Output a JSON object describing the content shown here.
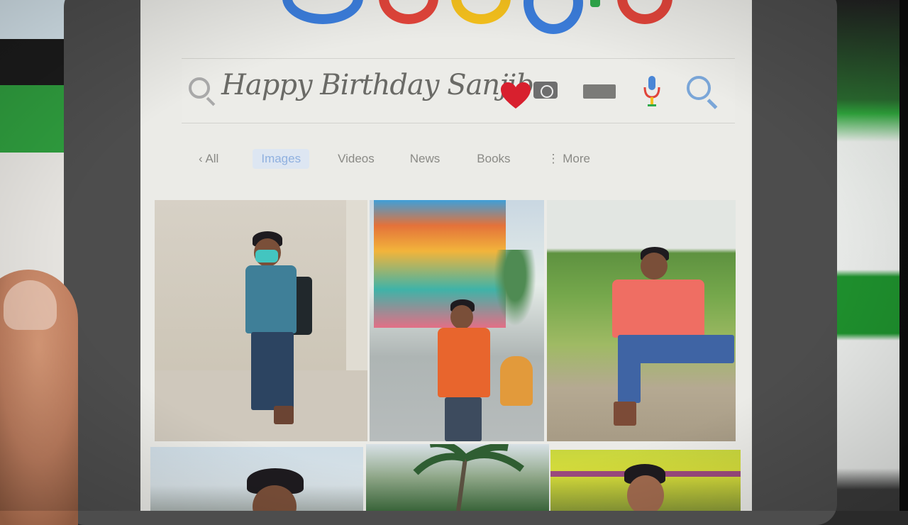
{
  "search": {
    "query": "Happy Birthday Sanjib"
  },
  "tabs": [
    {
      "label": "‹ All"
    },
    {
      "label": "Images",
      "active": true
    },
    {
      "label": "Videos"
    },
    {
      "label": "News"
    },
    {
      "label": "Books"
    },
    {
      "label": "⋮ More"
    }
  ],
  "icons": [
    "search-icon",
    "heart-icon",
    "camera-icon",
    "keyboard-icon",
    "microphone-icon",
    "search-submit-icon",
    "google-logo"
  ],
  "colors": {
    "google_blue": "#3b7ddb",
    "google_red": "#e0443a",
    "google_yellow": "#f4c01d",
    "google_green": "#2faa4b",
    "heart_red": "#d8202e",
    "active_tab": "#8fb0df"
  }
}
